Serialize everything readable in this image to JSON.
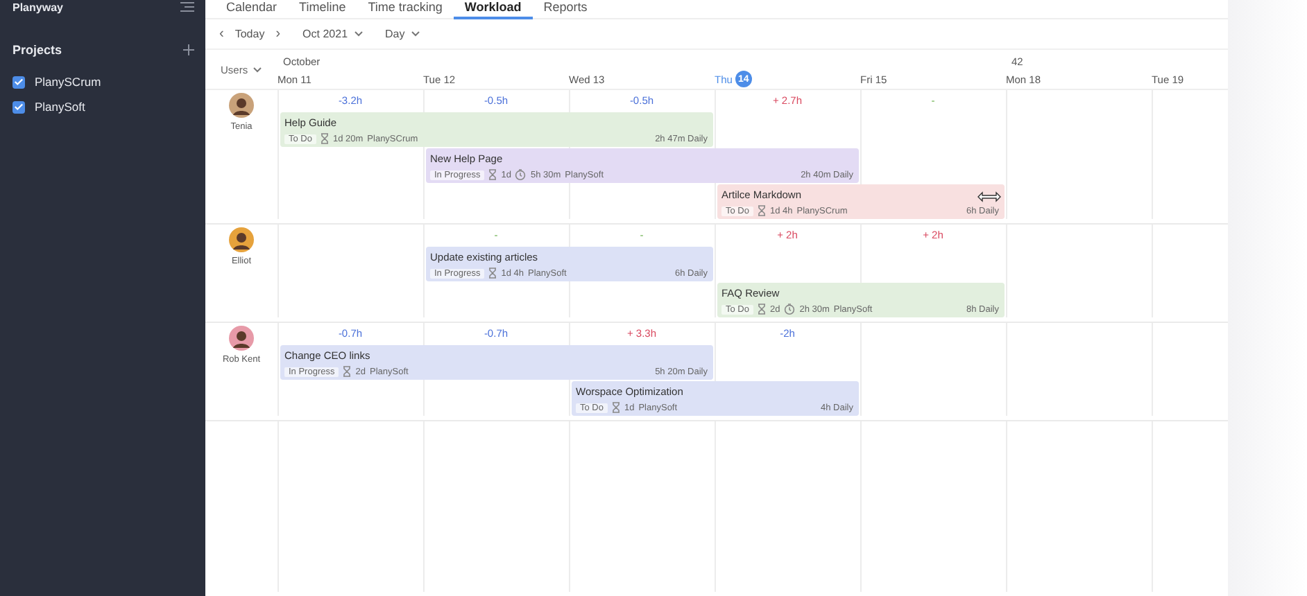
{
  "sidebar": {
    "logo": "Planyway",
    "projects_title": "Projects",
    "projects": [
      {
        "name": "PlanySCrum",
        "checked": true
      },
      {
        "name": "PlanySoft",
        "checked": true
      }
    ]
  },
  "tabs": [
    {
      "label": "Calendar",
      "selected": false
    },
    {
      "label": "Timeline",
      "selected": false
    },
    {
      "label": "Time tracking",
      "selected": false
    },
    {
      "label": "Workload",
      "selected": true
    },
    {
      "label": "Reports",
      "selected": false
    }
  ],
  "toolbar": {
    "prev": "‹",
    "today": "Today",
    "next": "›",
    "period": "Oct 2021",
    "scale": "Day"
  },
  "header": {
    "users": "Users",
    "days": [
      {
        "label": "Mon 11",
        "month": "October",
        "today": false
      },
      {
        "label": "Tue 12",
        "today": false
      },
      {
        "label": "Wed 13",
        "today": false
      },
      {
        "label": "Thu",
        "badge": "14",
        "today": true
      },
      {
        "label": "Fri 15",
        "today": false
      },
      {
        "label": "Mon 18",
        "week": "42",
        "today": false
      },
      {
        "label": "Tue 19",
        "today": false
      }
    ]
  },
  "users": [
    {
      "name": "Tenia",
      "deltas": [
        {
          "text": "-3.2h",
          "kind": "under"
        },
        {
          "text": "-0.5h",
          "kind": "under"
        },
        {
          "text": "-0.5h",
          "kind": "under"
        },
        {
          "text": "+ 2.7h",
          "kind": "over"
        },
        {
          "text": "-",
          "kind": "even"
        }
      ],
      "tasks": [
        {
          "title": "Help Guide",
          "status": "To Do",
          "duration": "1d 20m",
          "project": "PlanySCrum",
          "daily": "2h 47m Daily",
          "color": "#e2efde"
        },
        {
          "title": "New Help Page",
          "status": "In Progress",
          "duration": "1d",
          "tracked": "5h 30m",
          "project": "PlanySoft",
          "daily": "2h 40m Daily",
          "color": "#e3dbf4"
        },
        {
          "title": "Artilce Markdown",
          "status": "To Do",
          "duration": "1d 4h",
          "project": "PlanySCrum",
          "daily": "6h Daily",
          "color": "#f8e0e0"
        }
      ]
    },
    {
      "name": "Elliot",
      "deltas": [
        {
          "text": "-",
          "kind": "even"
        },
        {
          "text": "-",
          "kind": "even"
        },
        {
          "text": "+ 2h",
          "kind": "over"
        },
        {
          "text": "+ 2h",
          "kind": "over"
        }
      ],
      "tasks": [
        {
          "title": "Update existing articles",
          "status": "In Progress",
          "duration": "1d 4h",
          "project": "PlanySoft",
          "daily": "6h Daily",
          "color": "#dce1f6"
        },
        {
          "title": "FAQ Review",
          "status": "To Do",
          "duration": "2d",
          "tracked": "2h 30m",
          "project": "PlanySoft",
          "daily": "8h Daily",
          "color": "#e2efde"
        }
      ]
    },
    {
      "name": "Rob Kent",
      "deltas": [
        {
          "text": "-0.7h",
          "kind": "under"
        },
        {
          "text": "-0.7h",
          "kind": "under"
        },
        {
          "text": "+ 3.3h",
          "kind": "over"
        },
        {
          "text": "-2h",
          "kind": "under"
        }
      ],
      "tasks": [
        {
          "title": "Change CEO links",
          "status": "In Progress",
          "duration": "2d",
          "project": "PlanySoft",
          "daily": "5h 20m Daily",
          "color": "#dce1f6"
        },
        {
          "title": "Worspace Optimization",
          "status": "To Do",
          "duration": "1d",
          "project": "PlanySoft",
          "daily": "4h Daily",
          "color": "#dce1f6"
        }
      ]
    }
  ]
}
